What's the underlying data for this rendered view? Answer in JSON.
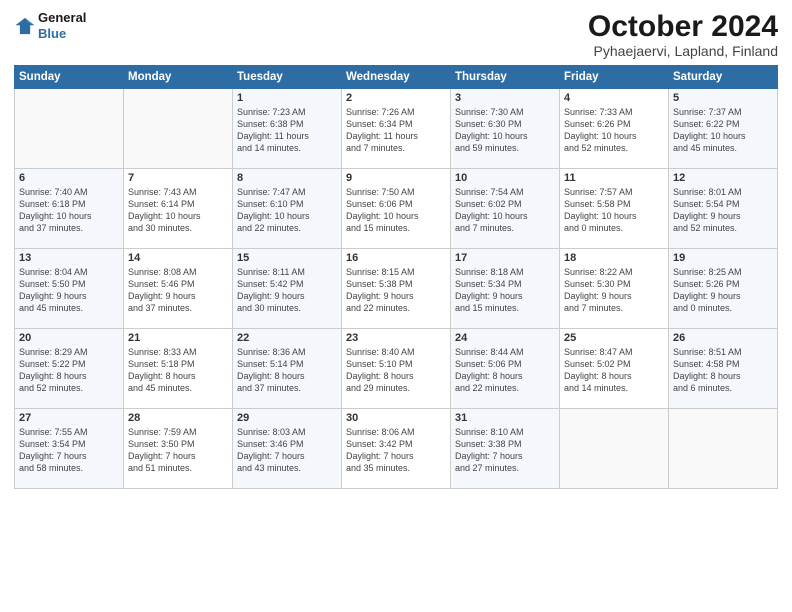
{
  "header": {
    "logo_line1": "General",
    "logo_line2": "Blue",
    "title": "October 2024",
    "subtitle": "Pyhaejaervi, Lapland, Finland"
  },
  "columns": [
    "Sunday",
    "Monday",
    "Tuesday",
    "Wednesday",
    "Thursday",
    "Friday",
    "Saturday"
  ],
  "weeks": [
    [
      {
        "day": "",
        "info": ""
      },
      {
        "day": "",
        "info": ""
      },
      {
        "day": "1",
        "info": "Sunrise: 7:23 AM\nSunset: 6:38 PM\nDaylight: 11 hours\nand 14 minutes."
      },
      {
        "day": "2",
        "info": "Sunrise: 7:26 AM\nSunset: 6:34 PM\nDaylight: 11 hours\nand 7 minutes."
      },
      {
        "day": "3",
        "info": "Sunrise: 7:30 AM\nSunset: 6:30 PM\nDaylight: 10 hours\nand 59 minutes."
      },
      {
        "day": "4",
        "info": "Sunrise: 7:33 AM\nSunset: 6:26 PM\nDaylight: 10 hours\nand 52 minutes."
      },
      {
        "day": "5",
        "info": "Sunrise: 7:37 AM\nSunset: 6:22 PM\nDaylight: 10 hours\nand 45 minutes."
      }
    ],
    [
      {
        "day": "6",
        "info": "Sunrise: 7:40 AM\nSunset: 6:18 PM\nDaylight: 10 hours\nand 37 minutes."
      },
      {
        "day": "7",
        "info": "Sunrise: 7:43 AM\nSunset: 6:14 PM\nDaylight: 10 hours\nand 30 minutes."
      },
      {
        "day": "8",
        "info": "Sunrise: 7:47 AM\nSunset: 6:10 PM\nDaylight: 10 hours\nand 22 minutes."
      },
      {
        "day": "9",
        "info": "Sunrise: 7:50 AM\nSunset: 6:06 PM\nDaylight: 10 hours\nand 15 minutes."
      },
      {
        "day": "10",
        "info": "Sunrise: 7:54 AM\nSunset: 6:02 PM\nDaylight: 10 hours\nand 7 minutes."
      },
      {
        "day": "11",
        "info": "Sunrise: 7:57 AM\nSunset: 5:58 PM\nDaylight: 10 hours\nand 0 minutes."
      },
      {
        "day": "12",
        "info": "Sunrise: 8:01 AM\nSunset: 5:54 PM\nDaylight: 9 hours\nand 52 minutes."
      }
    ],
    [
      {
        "day": "13",
        "info": "Sunrise: 8:04 AM\nSunset: 5:50 PM\nDaylight: 9 hours\nand 45 minutes."
      },
      {
        "day": "14",
        "info": "Sunrise: 8:08 AM\nSunset: 5:46 PM\nDaylight: 9 hours\nand 37 minutes."
      },
      {
        "day": "15",
        "info": "Sunrise: 8:11 AM\nSunset: 5:42 PM\nDaylight: 9 hours\nand 30 minutes."
      },
      {
        "day": "16",
        "info": "Sunrise: 8:15 AM\nSunset: 5:38 PM\nDaylight: 9 hours\nand 22 minutes."
      },
      {
        "day": "17",
        "info": "Sunrise: 8:18 AM\nSunset: 5:34 PM\nDaylight: 9 hours\nand 15 minutes."
      },
      {
        "day": "18",
        "info": "Sunrise: 8:22 AM\nSunset: 5:30 PM\nDaylight: 9 hours\nand 7 minutes."
      },
      {
        "day": "19",
        "info": "Sunrise: 8:25 AM\nSunset: 5:26 PM\nDaylight: 9 hours\nand 0 minutes."
      }
    ],
    [
      {
        "day": "20",
        "info": "Sunrise: 8:29 AM\nSunset: 5:22 PM\nDaylight: 8 hours\nand 52 minutes."
      },
      {
        "day": "21",
        "info": "Sunrise: 8:33 AM\nSunset: 5:18 PM\nDaylight: 8 hours\nand 45 minutes."
      },
      {
        "day": "22",
        "info": "Sunrise: 8:36 AM\nSunset: 5:14 PM\nDaylight: 8 hours\nand 37 minutes."
      },
      {
        "day": "23",
        "info": "Sunrise: 8:40 AM\nSunset: 5:10 PM\nDaylight: 8 hours\nand 29 minutes."
      },
      {
        "day": "24",
        "info": "Sunrise: 8:44 AM\nSunset: 5:06 PM\nDaylight: 8 hours\nand 22 minutes."
      },
      {
        "day": "25",
        "info": "Sunrise: 8:47 AM\nSunset: 5:02 PM\nDaylight: 8 hours\nand 14 minutes."
      },
      {
        "day": "26",
        "info": "Sunrise: 8:51 AM\nSunset: 4:58 PM\nDaylight: 8 hours\nand 6 minutes."
      }
    ],
    [
      {
        "day": "27",
        "info": "Sunrise: 7:55 AM\nSunset: 3:54 PM\nDaylight: 7 hours\nand 58 minutes."
      },
      {
        "day": "28",
        "info": "Sunrise: 7:59 AM\nSunset: 3:50 PM\nDaylight: 7 hours\nand 51 minutes."
      },
      {
        "day": "29",
        "info": "Sunrise: 8:03 AM\nSunset: 3:46 PM\nDaylight: 7 hours\nand 43 minutes."
      },
      {
        "day": "30",
        "info": "Sunrise: 8:06 AM\nSunset: 3:42 PM\nDaylight: 7 hours\nand 35 minutes."
      },
      {
        "day": "31",
        "info": "Sunrise: 8:10 AM\nSunset: 3:38 PM\nDaylight: 7 hours\nand 27 minutes."
      },
      {
        "day": "",
        "info": ""
      },
      {
        "day": "",
        "info": ""
      }
    ]
  ]
}
